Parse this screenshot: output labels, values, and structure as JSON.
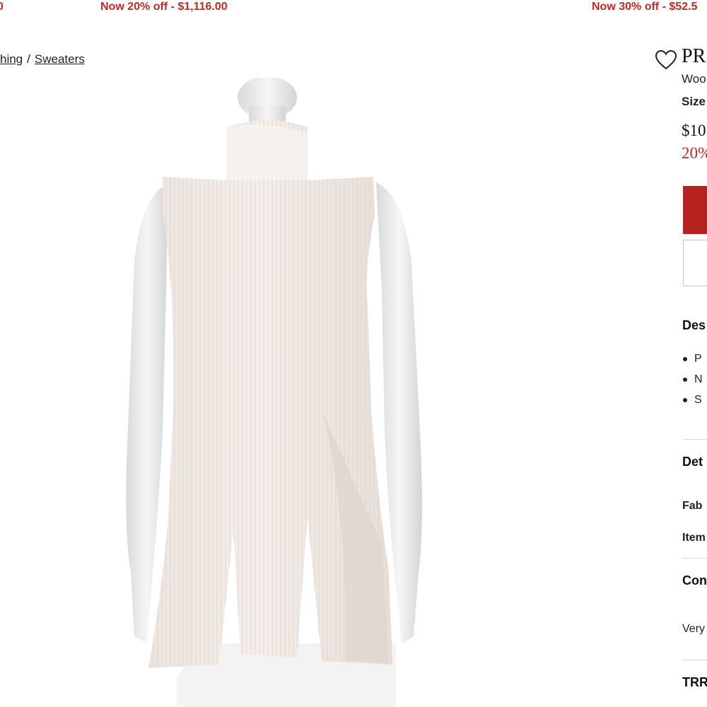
{
  "promos": [
    {
      "text": "Now 20% off - $1,116.00"
    },
    {
      "text": "Now 30% off - $52.5"
    }
  ],
  "breadcrumb": {
    "items": [
      "hing",
      "Sweaters"
    ],
    "separator": "/"
  },
  "product": {
    "brand": "PR",
    "subtitle": "Woo",
    "size_label": "Size",
    "price": "$10",
    "discount": "20%",
    "image_icon": "sleeveless-turtleneck-sweater-on-mannequin",
    "colors": {
      "accent": "#c22a25",
      "button": "#b5221f",
      "garment": "#efe9e4"
    }
  },
  "sections": {
    "description_title": "Des",
    "bullets": [
      "P",
      "N",
      "S"
    ],
    "details_title": "Det",
    "fabric_label": "Fab",
    "item_label": "Item",
    "condition_title": "Con",
    "condition_text": "Very",
    "trr_title": "TRR"
  }
}
